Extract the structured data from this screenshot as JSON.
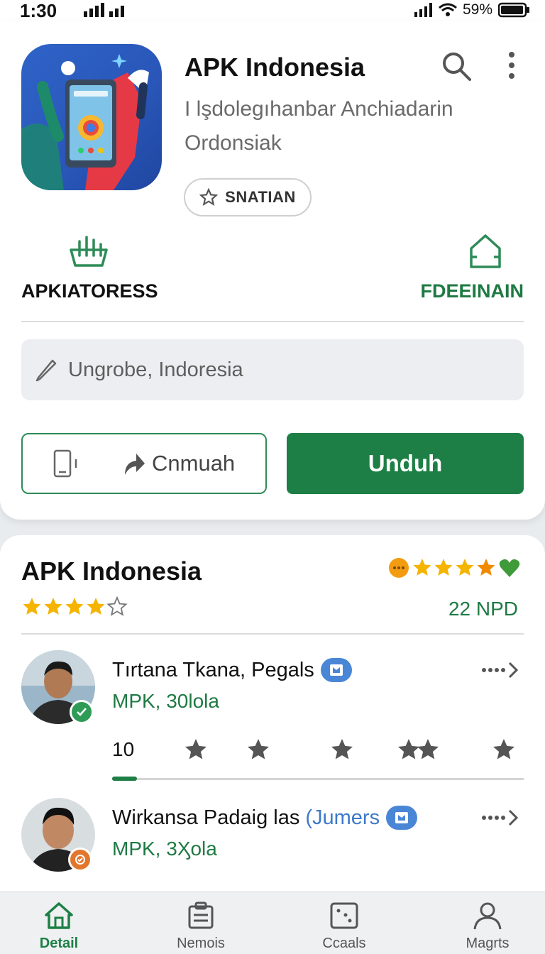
{
  "status": {
    "time": "1:30",
    "battery": "59%"
  },
  "app": {
    "title": "APK Indonesia",
    "subtitle": "I lşdolegıhanbar Anchiadarin Ordonsiak",
    "follow_label": "SNATIAN"
  },
  "quick_actions": {
    "left_label": "APKIATORESS",
    "right_label": "FDEEINAIN"
  },
  "location": {
    "value": "Ungrobe, Indoresia"
  },
  "buttons": {
    "share_label": "Cnmuah",
    "download_label": "Unduh"
  },
  "reviews": {
    "title": "APK Indonesia",
    "rating_stars": 4,
    "count_label": "22 NPD",
    "items": [
      {
        "name": "Tırtana Tkana, Pegals",
        "meta": "MPK, 30lola",
        "rating_number": "10",
        "progress": 0.06,
        "badge_color": "#2e9b57"
      },
      {
        "name": "Wirkansa Padaig las",
        "name_extra": "(Jumers",
        "meta": "MPK, 3Ӽola",
        "badge_color": "#e2762d"
      }
    ]
  },
  "nav": {
    "items": [
      {
        "label": "Detail",
        "icon": "home-icon",
        "active": true
      },
      {
        "label": "Nemois",
        "icon": "clipboard-icon",
        "active": false
      },
      {
        "label": "Ccaals",
        "icon": "dice-icon",
        "active": false
      },
      {
        "label": "Magrts",
        "icon": "person-icon",
        "active": false
      }
    ]
  },
  "colors": {
    "accent": "#1d7f45",
    "star": "#f4b400",
    "link_blue": "#3d79c9"
  }
}
